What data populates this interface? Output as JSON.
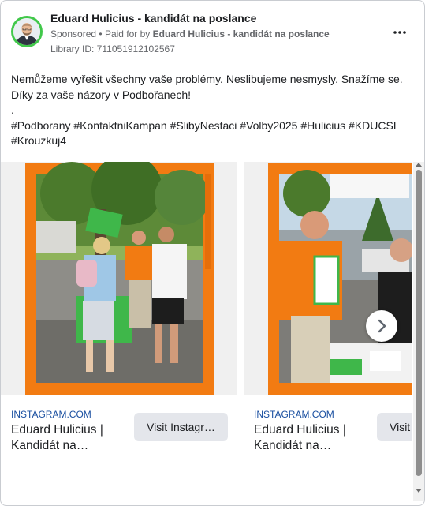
{
  "ad": {
    "page_name": "Eduard Hulicius - kandidát na poslance",
    "sponsored": "Sponsored",
    "paid_for_prefix": "Paid for by",
    "paid_for_by": "Eduard Hulicius - kandidát na poslance",
    "library_id": "Library ID: 711051912102567",
    "more_icon": "more-horizontal-icon",
    "body_lines": [
      "Nemůžeme vyřešit všechny vaše problémy. Neslibujeme nesmysly. Snažíme se.",
      "Díky za vaše názory v Podbořanech!",
      ".",
      "#Podborany #KontaktniKampan #SlibyNestaci #Volby2025 #Hulicius #KDUCSL",
      "#Krouzkuj4"
    ]
  },
  "carousel": {
    "cards": [
      {
        "domain": "INSTAGRAM.COM",
        "title_lines": [
          "Eduard Hulicius |",
          "Kandidát na…"
        ],
        "button_label": "Visit Instagr…"
      },
      {
        "domain": "INSTAGRAM.COM",
        "title_lines": [
          "Eduard Hulicius |",
          "Kandidát na…"
        ],
        "button_label": "Visit Instagr…"
      }
    ],
    "next_icon": "chevron-right-icon"
  },
  "colors": {
    "brand_orange": "#f27b12",
    "campaign_green": "#3fb74a",
    "link_blue": "#1a4fa0",
    "button_gray": "#e4e6eb"
  }
}
